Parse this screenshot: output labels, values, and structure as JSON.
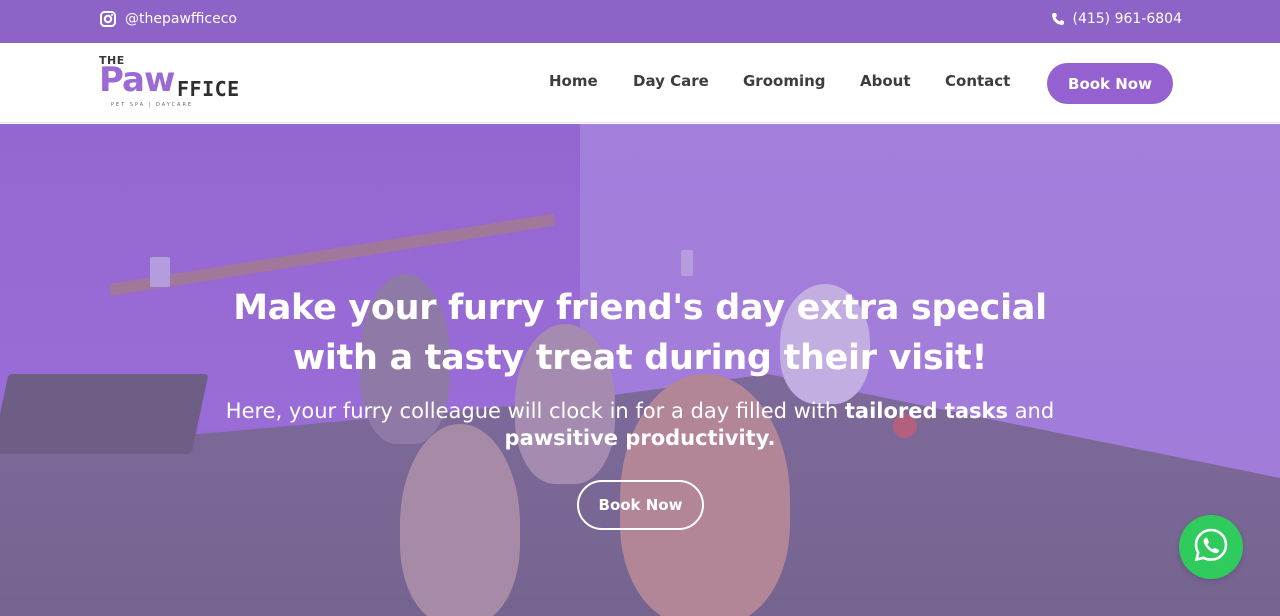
{
  "topbar": {
    "instagram_handle": "@thepawfficeco",
    "phone": "(415) 961-6804"
  },
  "brand": {
    "logo_the": "THE",
    "logo_paw": "Paw",
    "logo_ffice": "FFICE",
    "logo_tagline": "PET SPA | DAYCARE"
  },
  "nav": {
    "items": [
      {
        "label": "Home"
      },
      {
        "label": "Day Care"
      },
      {
        "label": "Grooming"
      },
      {
        "label": "About"
      },
      {
        "label": "Contact"
      }
    ],
    "book_label": "Book Now"
  },
  "hero": {
    "title_line1": "Make your furry friend's day extra special",
    "title_line2": "with a tasty treat during their visit!",
    "sub_part1": "Here, your furry colleague will clock in for a day filled with ",
    "sub_bold1": "tailored tasks",
    "sub_part2": " and",
    "sub_bold2": "pawsitive productivity.",
    "button_label": "Book Now"
  },
  "icons": {
    "instagram": "instagram-icon",
    "phone": "phone-icon",
    "whatsapp": "whatsapp-icon"
  },
  "colors": {
    "accent": "#9560cf",
    "topbar": "#8e63c7",
    "whatsapp": "#2fcb5c"
  }
}
